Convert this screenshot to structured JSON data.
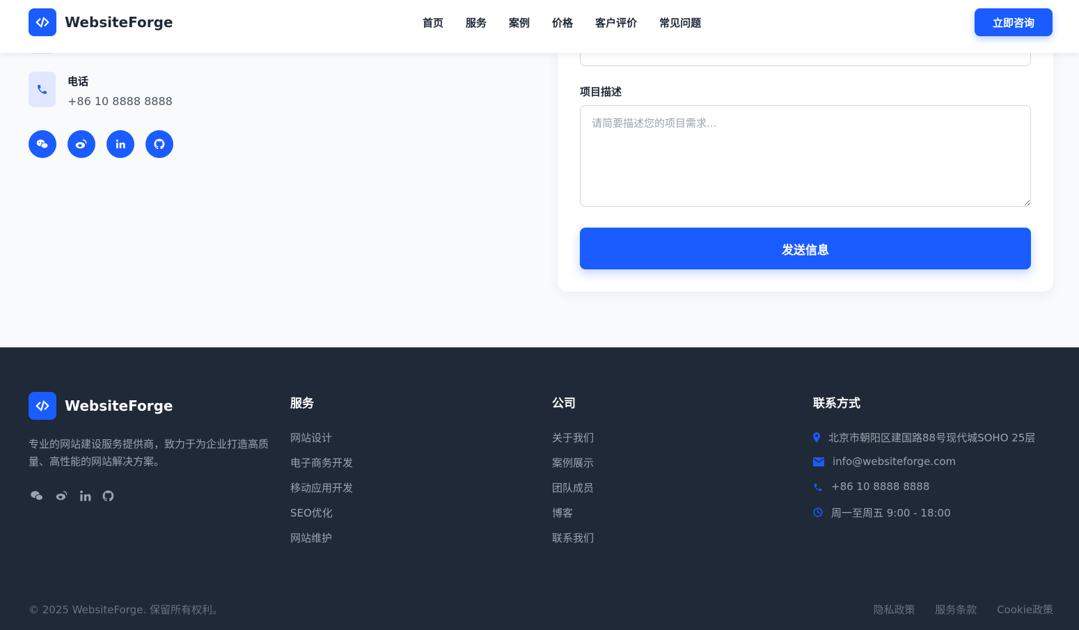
{
  "header": {
    "brand": "WebsiteForge",
    "nav": [
      "首页",
      "服务",
      "案例",
      "价格",
      "客户评价",
      "常见问题"
    ],
    "cta": "立即咨询"
  },
  "contact_info": {
    "phone_label": "电话",
    "phone_value": "+86 10 8888 8888"
  },
  "social_icons": [
    "wechat-icon",
    "weibo-icon",
    "linkedin-icon",
    "github-icon"
  ],
  "form": {
    "description_label": "项目描述",
    "description_placeholder": "请简要描述您的项目需求...",
    "submit_label": "发送信息"
  },
  "footer": {
    "brand": "WebsiteForge",
    "description": "专业的网站建设服务提供商，致力于为企业打造高质量、高性能的网站解决方案。",
    "services": {
      "title": "服务",
      "links": [
        "网站设计",
        "电子商务开发",
        "移动应用开发",
        "SEO优化",
        "网站维护"
      ]
    },
    "company": {
      "title": "公司",
      "links": [
        "关于我们",
        "案例展示",
        "团队成员",
        "博客",
        "联系我们"
      ]
    },
    "contact": {
      "title": "联系方式",
      "address": "北京市朝阳区建国路88号现代城SOHO 25层",
      "email": "info@websiteforge.com",
      "phone": "+86 10 8888 8888",
      "hours": "周一至周五 9:00 - 18:00"
    },
    "copyright": "© 2025 WebsiteForge. 保留所有权利。",
    "legal_links": [
      "隐私政策",
      "服务条款",
      "Cookie政策"
    ]
  },
  "colors": {
    "accent": "#1a5cff",
    "footer_bg": "#1f2937",
    "page_bg": "#f8fafc"
  }
}
